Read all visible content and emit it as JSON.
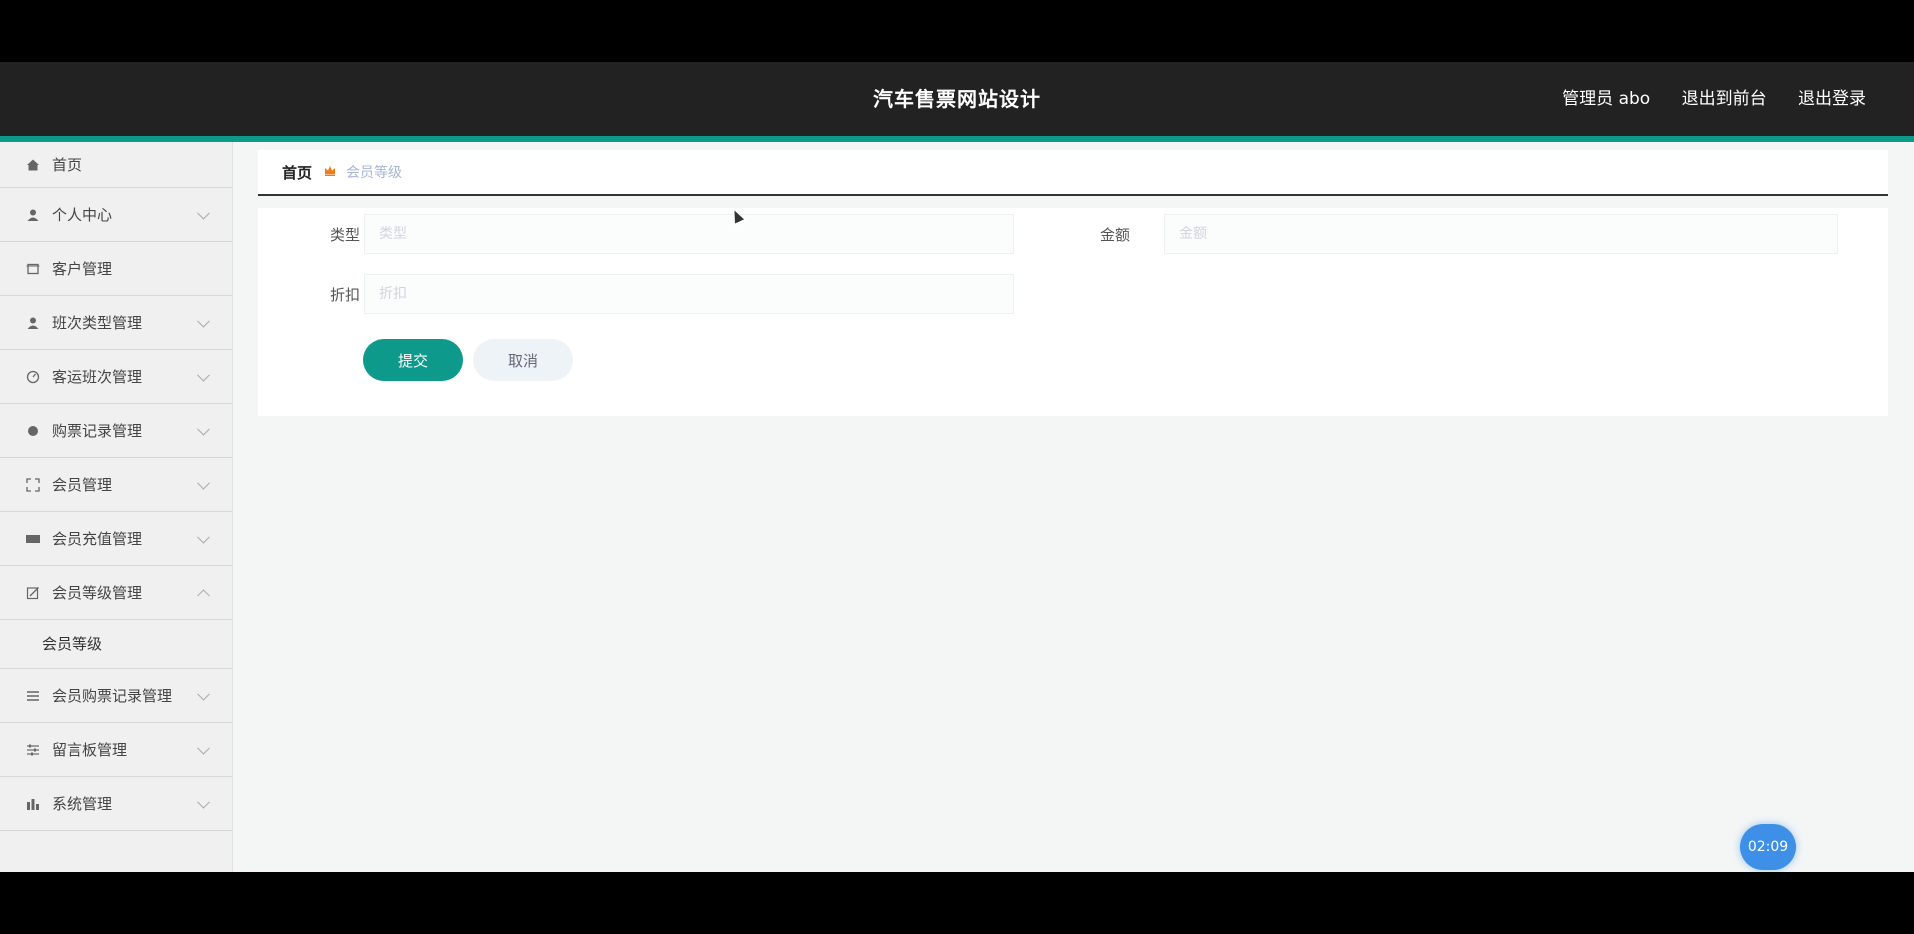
{
  "header": {
    "title": "汽车售票网站设计",
    "user_label": "管理员 abo",
    "to_front_label": "退出到前台",
    "logout_label": "退出登录"
  },
  "sidebar": {
    "items": [
      {
        "label": "首页",
        "icon": "home-icon"
      },
      {
        "label": "个人中心",
        "icon": "user-icon"
      },
      {
        "label": "客户管理",
        "icon": "frame-icon"
      },
      {
        "label": "班次类型管理",
        "icon": "user-icon"
      },
      {
        "label": "客运班次管理",
        "icon": "gauge-icon"
      },
      {
        "label": "购票记录管理",
        "icon": "sphere-icon"
      },
      {
        "label": "会员管理",
        "icon": "expand-icon"
      },
      {
        "label": "会员充值管理",
        "icon": "ticket-icon"
      },
      {
        "label": "会员等级管理",
        "icon": "edit-icon"
      },
      {
        "label": "会员购票记录管理",
        "icon": "list-icon"
      },
      {
        "label": "留言板管理",
        "icon": "sliders-icon"
      },
      {
        "label": "系统管理",
        "icon": "bar-chart-icon"
      }
    ],
    "sub_item": "会员等级"
  },
  "breadcrumb": {
    "home": "首页",
    "current": "会员等级"
  },
  "form": {
    "type_label": "类型",
    "type_placeholder": "类型",
    "amount_label": "金额",
    "amount_placeholder": "金额",
    "discount_label": "折扣",
    "discount_placeholder": "折扣",
    "submit_label": "提交",
    "cancel_label": "取消"
  },
  "clock": "02:09",
  "colors": {
    "accent": "#0d9a8a",
    "topbar": "#222222",
    "crumb_icon": "#f07b1d"
  }
}
